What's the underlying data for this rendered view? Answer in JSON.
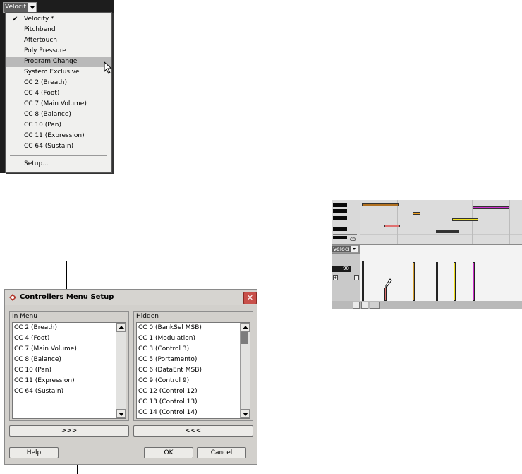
{
  "menu": {
    "header_label": "Velocit",
    "items": [
      {
        "label": "Velocity *",
        "checked": true,
        "highlighted": false
      },
      {
        "label": "Pitchbend",
        "checked": false,
        "highlighted": false
      },
      {
        "label": "Aftertouch",
        "checked": false,
        "highlighted": false
      },
      {
        "label": "Poly Pressure",
        "checked": false,
        "highlighted": false
      },
      {
        "label": "Program Change",
        "checked": false,
        "highlighted": true
      },
      {
        "label": "System Exclusive",
        "checked": false,
        "highlighted": false
      },
      {
        "label": "CC 2  (Breath)",
        "checked": false,
        "highlighted": false
      },
      {
        "label": "CC 4  (Foot)",
        "checked": false,
        "highlighted": false
      },
      {
        "label": "CC 7  (Main Volume)",
        "checked": false,
        "highlighted": false
      },
      {
        "label": "CC 8  (Balance)",
        "checked": false,
        "highlighted": false
      },
      {
        "label": "CC 10  (Pan)",
        "checked": false,
        "highlighted": false
      },
      {
        "label": "CC 11  (Expression)",
        "checked": false,
        "highlighted": false
      },
      {
        "label": "CC 64  (Sustain)",
        "checked": false,
        "highlighted": false
      }
    ],
    "setup_label": "Setup...",
    "check_glyph": "✔"
  },
  "dialog": {
    "title": "Controllers Menu Setup",
    "close_glyph": "✕",
    "in_menu": {
      "label": "In Menu",
      "items": [
        "CC 2  (Breath)",
        "CC 4  (Foot)",
        "CC 7  (Main Volume)",
        "CC 8  (Balance)",
        "CC 10  (Pan)",
        "CC 11  (Expression)",
        "CC 64  (Sustain)"
      ]
    },
    "hidden": {
      "label": "Hidden",
      "items": [
        "CC 0  (BankSel MSB)",
        "CC 1  (Modulation)",
        "CC 3  (Control 3)",
        "CC 5  (Portamento)",
        "CC 6  (DataEnt MSB)",
        "CC 9  (Control 9)",
        "CC 12  (Control 12)",
        "CC 13  (Control 13)",
        "CC 14  (Control 14)"
      ]
    },
    "move_right_label": ">>>",
    "move_left_label": "<<<",
    "help_label": "Help",
    "ok_label": "OK",
    "cancel_label": "Cancel"
  },
  "key_editor": {
    "controller_label": "Veloci",
    "value": "90",
    "octave_label": "C3",
    "note_colors": [
      "#b07020",
      "#f0a020",
      "#f0e020",
      "#e05060",
      "#cc30cc",
      "#303030"
    ],
    "velocity_colors": [
      "#c08030",
      "#d8a030",
      "#202020",
      "#f0e020",
      "#cc30cc",
      "#e07070"
    ]
  }
}
